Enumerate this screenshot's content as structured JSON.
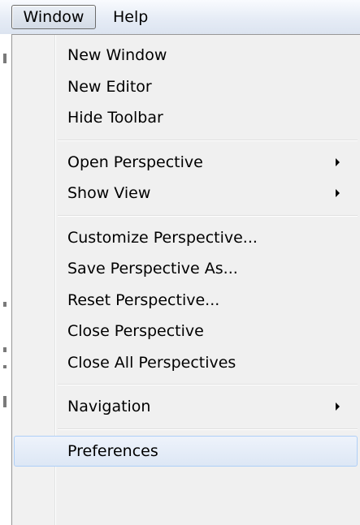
{
  "menubar": {
    "items": [
      {
        "label": "Window"
      },
      {
        "label": "Help"
      }
    ]
  },
  "menu": {
    "groups": [
      [
        {
          "label": "New Window",
          "submenu": false
        },
        {
          "label": "New Editor",
          "submenu": false
        },
        {
          "label": "Hide Toolbar",
          "submenu": false
        }
      ],
      [
        {
          "label": "Open Perspective",
          "submenu": true
        },
        {
          "label": "Show View",
          "submenu": true
        }
      ],
      [
        {
          "label": "Customize Perspective...",
          "submenu": false
        },
        {
          "label": "Save Perspective As...",
          "submenu": false
        },
        {
          "label": "Reset Perspective...",
          "submenu": false
        },
        {
          "label": "Close Perspective",
          "submenu": false
        },
        {
          "label": "Close All Perspectives",
          "submenu": false
        }
      ],
      [
        {
          "label": "Navigation",
          "submenu": true
        }
      ],
      [
        {
          "label": "Preferences",
          "submenu": false,
          "highlighted": true
        }
      ]
    ]
  }
}
